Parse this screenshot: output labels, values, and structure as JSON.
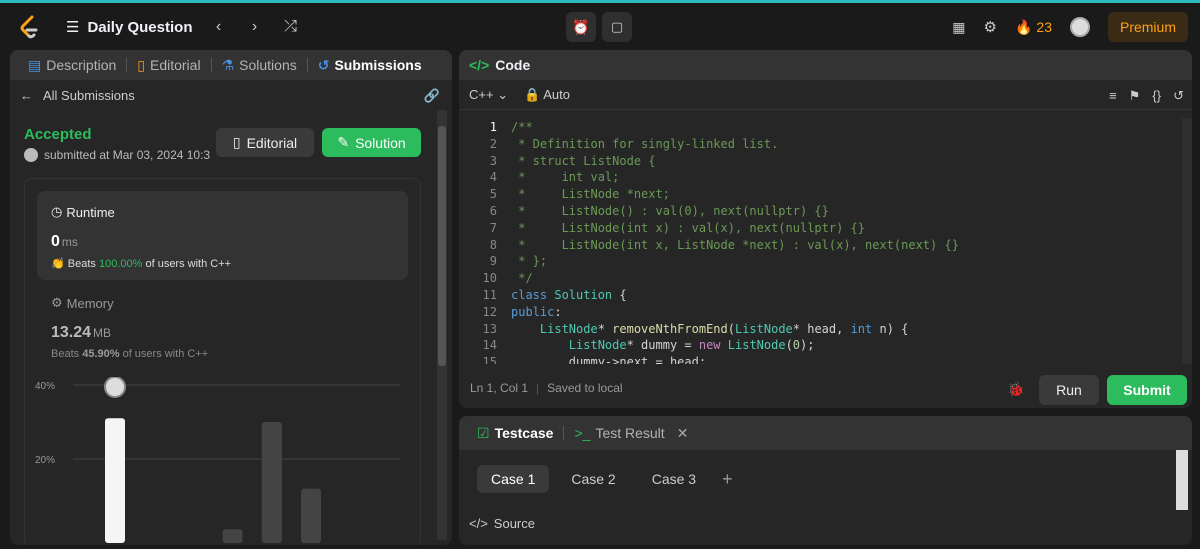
{
  "topbar": {
    "title": "Daily Question",
    "streak": "23",
    "premium": "Premium"
  },
  "left_tabs": [
    "Description",
    "Editorial",
    "Solutions",
    "Submissions"
  ],
  "submission": {
    "back_label": "All Submissions",
    "status": "Accepted",
    "submitted": "submitted at Mar 03, 2024 10:3",
    "editorial_btn": "Editorial",
    "solution_btn": "Solution"
  },
  "runtime": {
    "title": "Runtime",
    "value": "0",
    "unit": "ms",
    "beats_prefix": "Beats",
    "beats": "100.00%",
    "beats_suffix": "of users with C++"
  },
  "memory": {
    "title": "Memory",
    "value": "13.24",
    "unit": "MB",
    "beats_prefix": "Beats",
    "beats": "45.90%",
    "beats_suffix": "of users with C++"
  },
  "chart_data": {
    "type": "bar",
    "yticks": [
      "40%",
      "20%"
    ],
    "values": [
      31,
      0,
      0,
      1,
      30,
      12,
      0,
      0,
      13
    ],
    "highlight_index": 0
  },
  "code": {
    "title": "Code",
    "language": "C++",
    "mode": "Auto",
    "lines": [
      "/**",
      " * Definition for singly-linked list.",
      " * struct ListNode {",
      " *     int val;",
      " *     ListNode *next;",
      " *     ListNode() : val(0), next(nullptr) {}",
      " *     ListNode(int x) : val(x), next(nullptr) {}",
      " *     ListNode(int x, ListNode *next) : val(x), next(next) {}",
      " * };",
      " */",
      "class Solution {",
      "public:",
      "    ListNode* removeNthFromEnd(ListNode* head, int n) {",
      "        ListNode* dummy = new ListNode(0);",
      "        dummy->next = head;"
    ],
    "status": "Ln 1, Col 1",
    "saved": "Saved to local",
    "run": "Run",
    "submit": "Submit"
  },
  "test": {
    "tabs": [
      "Testcase",
      "Test Result"
    ],
    "cases": [
      "Case 1",
      "Case 2",
      "Case 3"
    ],
    "source": "Source"
  }
}
